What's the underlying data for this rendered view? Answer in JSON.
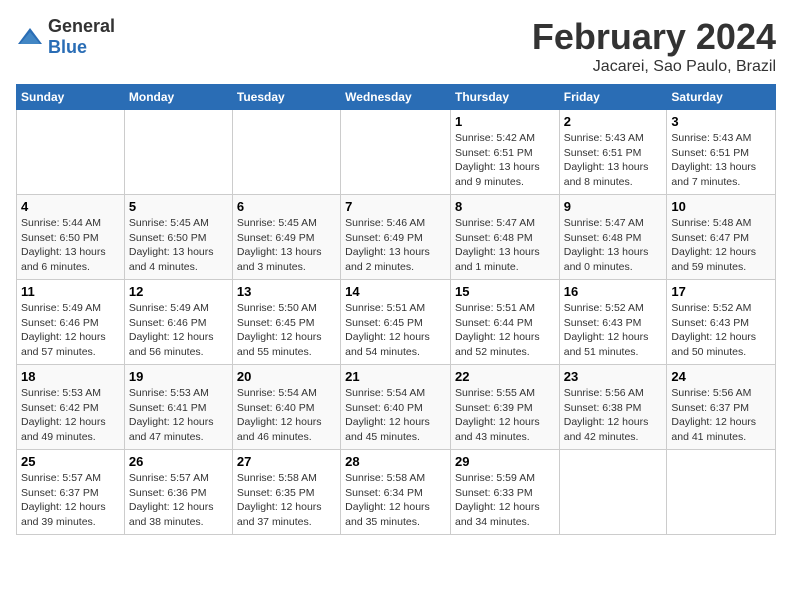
{
  "header": {
    "logo_general": "General",
    "logo_blue": "Blue",
    "month_title": "February 2024",
    "location": "Jacarei, Sao Paulo, Brazil"
  },
  "columns": [
    "Sunday",
    "Monday",
    "Tuesday",
    "Wednesday",
    "Thursday",
    "Friday",
    "Saturday"
  ],
  "weeks": [
    [
      {
        "day": "",
        "info": ""
      },
      {
        "day": "",
        "info": ""
      },
      {
        "day": "",
        "info": ""
      },
      {
        "day": "",
        "info": ""
      },
      {
        "day": "1",
        "info": "Sunrise: 5:42 AM\nSunset: 6:51 PM\nDaylight: 13 hours and 9 minutes."
      },
      {
        "day": "2",
        "info": "Sunrise: 5:43 AM\nSunset: 6:51 PM\nDaylight: 13 hours and 8 minutes."
      },
      {
        "day": "3",
        "info": "Sunrise: 5:43 AM\nSunset: 6:51 PM\nDaylight: 13 hours and 7 minutes."
      }
    ],
    [
      {
        "day": "4",
        "info": "Sunrise: 5:44 AM\nSunset: 6:50 PM\nDaylight: 13 hours and 6 minutes."
      },
      {
        "day": "5",
        "info": "Sunrise: 5:45 AM\nSunset: 6:50 PM\nDaylight: 13 hours and 4 minutes."
      },
      {
        "day": "6",
        "info": "Sunrise: 5:45 AM\nSunset: 6:49 PM\nDaylight: 13 hours and 3 minutes."
      },
      {
        "day": "7",
        "info": "Sunrise: 5:46 AM\nSunset: 6:49 PM\nDaylight: 13 hours and 2 minutes."
      },
      {
        "day": "8",
        "info": "Sunrise: 5:47 AM\nSunset: 6:48 PM\nDaylight: 13 hours and 1 minute."
      },
      {
        "day": "9",
        "info": "Sunrise: 5:47 AM\nSunset: 6:48 PM\nDaylight: 13 hours and 0 minutes."
      },
      {
        "day": "10",
        "info": "Sunrise: 5:48 AM\nSunset: 6:47 PM\nDaylight: 12 hours and 59 minutes."
      }
    ],
    [
      {
        "day": "11",
        "info": "Sunrise: 5:49 AM\nSunset: 6:46 PM\nDaylight: 12 hours and 57 minutes."
      },
      {
        "day": "12",
        "info": "Sunrise: 5:49 AM\nSunset: 6:46 PM\nDaylight: 12 hours and 56 minutes."
      },
      {
        "day": "13",
        "info": "Sunrise: 5:50 AM\nSunset: 6:45 PM\nDaylight: 12 hours and 55 minutes."
      },
      {
        "day": "14",
        "info": "Sunrise: 5:51 AM\nSunset: 6:45 PM\nDaylight: 12 hours and 54 minutes."
      },
      {
        "day": "15",
        "info": "Sunrise: 5:51 AM\nSunset: 6:44 PM\nDaylight: 12 hours and 52 minutes."
      },
      {
        "day": "16",
        "info": "Sunrise: 5:52 AM\nSunset: 6:43 PM\nDaylight: 12 hours and 51 minutes."
      },
      {
        "day": "17",
        "info": "Sunrise: 5:52 AM\nSunset: 6:43 PM\nDaylight: 12 hours and 50 minutes."
      }
    ],
    [
      {
        "day": "18",
        "info": "Sunrise: 5:53 AM\nSunset: 6:42 PM\nDaylight: 12 hours and 49 minutes."
      },
      {
        "day": "19",
        "info": "Sunrise: 5:53 AM\nSunset: 6:41 PM\nDaylight: 12 hours and 47 minutes."
      },
      {
        "day": "20",
        "info": "Sunrise: 5:54 AM\nSunset: 6:40 PM\nDaylight: 12 hours and 46 minutes."
      },
      {
        "day": "21",
        "info": "Sunrise: 5:54 AM\nSunset: 6:40 PM\nDaylight: 12 hours and 45 minutes."
      },
      {
        "day": "22",
        "info": "Sunrise: 5:55 AM\nSunset: 6:39 PM\nDaylight: 12 hours and 43 minutes."
      },
      {
        "day": "23",
        "info": "Sunrise: 5:56 AM\nSunset: 6:38 PM\nDaylight: 12 hours and 42 minutes."
      },
      {
        "day": "24",
        "info": "Sunrise: 5:56 AM\nSunset: 6:37 PM\nDaylight: 12 hours and 41 minutes."
      }
    ],
    [
      {
        "day": "25",
        "info": "Sunrise: 5:57 AM\nSunset: 6:37 PM\nDaylight: 12 hours and 39 minutes."
      },
      {
        "day": "26",
        "info": "Sunrise: 5:57 AM\nSunset: 6:36 PM\nDaylight: 12 hours and 38 minutes."
      },
      {
        "day": "27",
        "info": "Sunrise: 5:58 AM\nSunset: 6:35 PM\nDaylight: 12 hours and 37 minutes."
      },
      {
        "day": "28",
        "info": "Sunrise: 5:58 AM\nSunset: 6:34 PM\nDaylight: 12 hours and 35 minutes."
      },
      {
        "day": "29",
        "info": "Sunrise: 5:59 AM\nSunset: 6:33 PM\nDaylight: 12 hours and 34 minutes."
      },
      {
        "day": "",
        "info": ""
      },
      {
        "day": "",
        "info": ""
      }
    ]
  ]
}
